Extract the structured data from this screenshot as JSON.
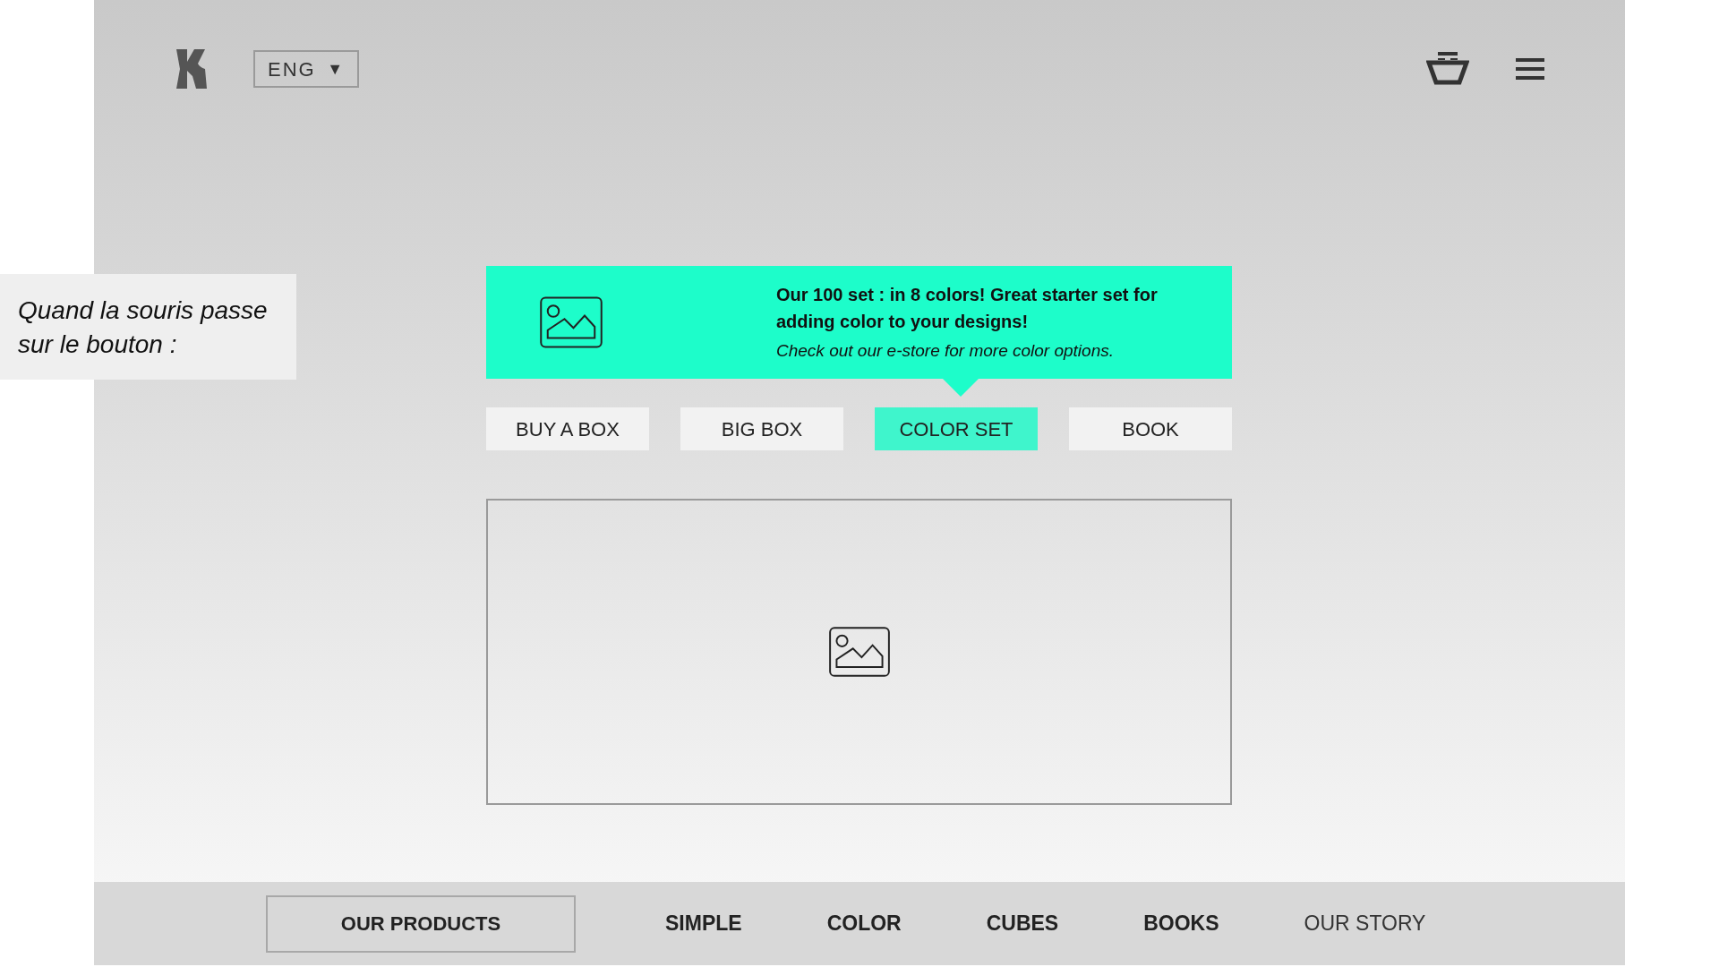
{
  "annotation": {
    "text": "Quand la souris passe sur le bouton :"
  },
  "header": {
    "language": "ENG",
    "language_caret": "▼"
  },
  "banner": {
    "headline": "Our 100 set : in 8 colors! Great starter set for adding color to your designs!",
    "subline": "Check out our e-store for more color options."
  },
  "tabs": [
    {
      "label": "BUY A BOX",
      "selected": false
    },
    {
      "label": "BIG BOX",
      "selected": false
    },
    {
      "label": "COLOR SET",
      "selected": true
    },
    {
      "label": "BOOK",
      "selected": false
    }
  ],
  "footer_nav": [
    {
      "label": "OUR PRODUCTS",
      "kind": "boxed"
    },
    {
      "label": "SIMPLE",
      "kind": "bold"
    },
    {
      "label": "COLOR",
      "kind": "bold"
    },
    {
      "label": "CUBES",
      "kind": "bold"
    },
    {
      "label": "BOOKS",
      "kind": "bold"
    },
    {
      "label": "OUR STORY",
      "kind": "plain"
    }
  ]
}
